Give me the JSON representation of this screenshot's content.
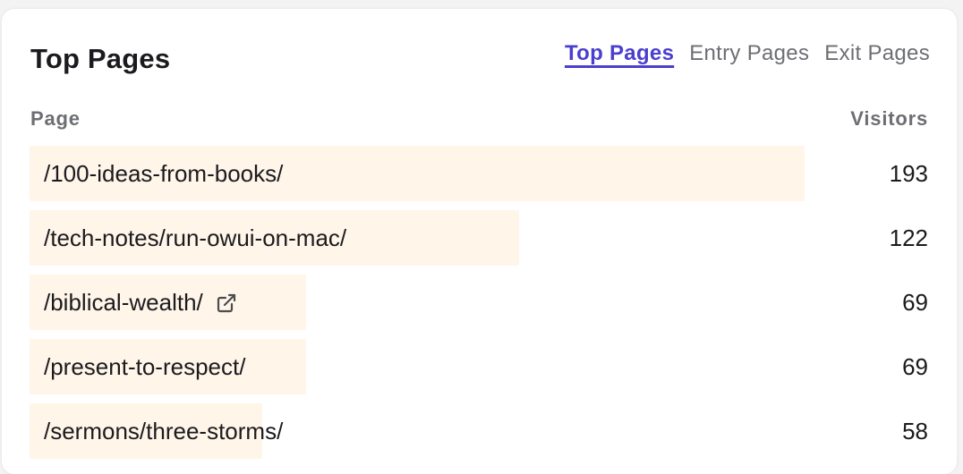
{
  "widget": {
    "title": "Top Pages",
    "tabs": [
      {
        "label": "Top Pages",
        "active": true
      },
      {
        "label": "Entry Pages",
        "active": false
      },
      {
        "label": "Exit Pages",
        "active": false
      }
    ],
    "columns": {
      "page": "Page",
      "visitors": "Visitors"
    },
    "rows": [
      {
        "path": "/100-ideas-from-books/",
        "visitors": "193",
        "share": 1.0,
        "external_link": false
      },
      {
        "path": "/tech-notes/run-owui-on-mac/",
        "visitors": "122",
        "share": 0.632,
        "external_link": false
      },
      {
        "path": "/biblical-wealth/",
        "visitors": "69",
        "share": 0.357,
        "external_link": true
      },
      {
        "path": "/present-to-respect/",
        "visitors": "69",
        "share": 0.357,
        "external_link": false
      },
      {
        "path": "/sermons/three-storms/",
        "visitors": "58",
        "share": 0.3,
        "external_link": false
      }
    ]
  },
  "colors": {
    "accent": "#4a3fce",
    "bar": "#fff5e8",
    "text": "#1b1b1f",
    "muted": "#6d6e73"
  },
  "icons": {
    "external_link": "external-link-icon"
  }
}
